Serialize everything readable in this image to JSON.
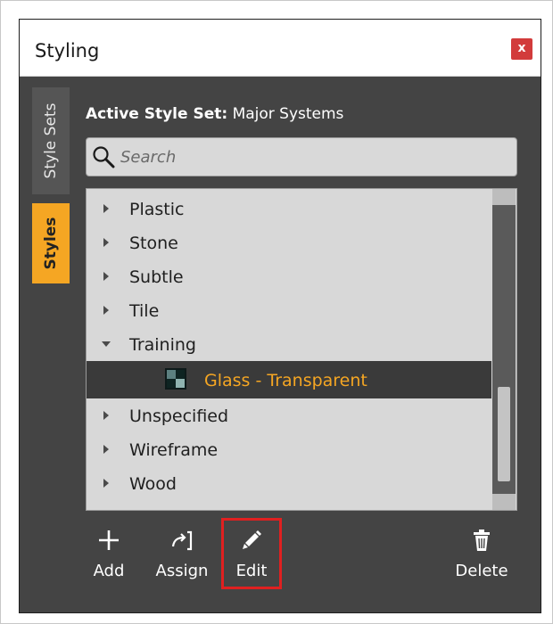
{
  "window": {
    "title": "Styling",
    "close_label": "x"
  },
  "side_tabs": [
    {
      "label": "Style Sets",
      "active": false
    },
    {
      "label": "Styles",
      "active": true
    }
  ],
  "header": {
    "active_set_label": "Active Style Set:",
    "active_set_value": "Major Systems"
  },
  "search": {
    "placeholder": "Search",
    "icon": "search-icon"
  },
  "tree": {
    "items": [
      {
        "label": "Plastic",
        "expanded": false
      },
      {
        "label": "Stone",
        "expanded": false
      },
      {
        "label": "Subtle",
        "expanded": false
      },
      {
        "label": "Tile",
        "expanded": false
      },
      {
        "label": "Training",
        "expanded": true
      },
      {
        "label": "Glass - Transparent",
        "child": true,
        "selected": true
      },
      {
        "label": "Unspecified",
        "expanded": false
      },
      {
        "label": "Wireframe",
        "expanded": false
      },
      {
        "label": "Wood",
        "expanded": false
      }
    ]
  },
  "toolbar": {
    "add_label": "Add",
    "assign_label": "Assign",
    "edit_label": "Edit",
    "delete_label": "Delete",
    "highlighted": "Edit"
  },
  "colors": {
    "accent": "#f5a623",
    "panel_bg": "#444444",
    "close_button": "#d23b3b",
    "highlight_box": "#e02020"
  }
}
